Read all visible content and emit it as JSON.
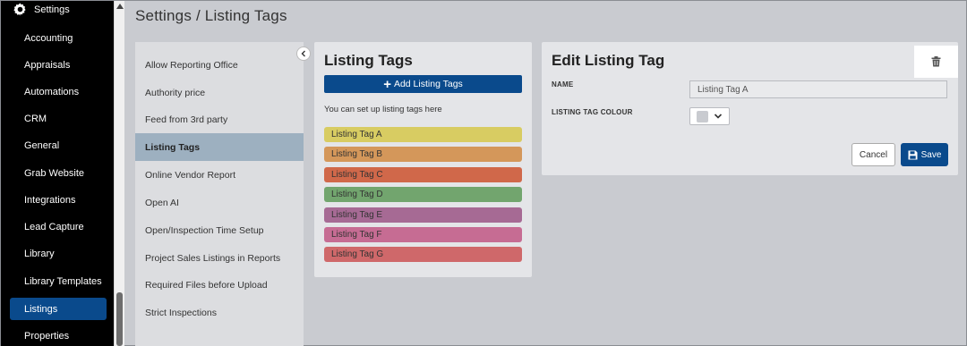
{
  "page_title": "Settings / Listing Tags",
  "sidebar": {
    "header_label": "Settings",
    "header_icon": "gear-icon",
    "items": [
      {
        "label": "Accounting"
      },
      {
        "label": "Appraisals"
      },
      {
        "label": "Automations"
      },
      {
        "label": "CRM"
      },
      {
        "label": "General"
      },
      {
        "label": "Grab Website"
      },
      {
        "label": "Integrations"
      },
      {
        "label": "Lead Capture"
      },
      {
        "label": "Library"
      },
      {
        "label": "Library Templates"
      },
      {
        "label": "Listings",
        "active": true
      },
      {
        "label": "Properties"
      }
    ]
  },
  "submenu": {
    "collapse_icon": "chevron-left-icon",
    "items": [
      {
        "label": "Allow Reporting Office"
      },
      {
        "label": "Authority price"
      },
      {
        "label": "Feed from 3rd party"
      },
      {
        "label": "Listing Tags",
        "active": true
      },
      {
        "label": "Online Vendor Report"
      },
      {
        "label": "Open AI"
      },
      {
        "label": "Open/Inspection Time Setup"
      },
      {
        "label": "Project Sales Listings in Reports"
      },
      {
        "label": "Required Files before Upload"
      },
      {
        "label": "Strict Inspections"
      }
    ]
  },
  "listing_tags": {
    "title": "Listing Tags",
    "add_button_label": "Add Listing Tags",
    "helper_text": "You can set up listing tags here",
    "tags": [
      {
        "label": "Listing Tag A",
        "color": "#d8cc62"
      },
      {
        "label": "Listing Tag B",
        "color": "#d4975a"
      },
      {
        "label": "Listing Tag C",
        "color": "#d0684a"
      },
      {
        "label": "Listing Tag D",
        "color": "#72a56e"
      },
      {
        "label": "Listing Tag E",
        "color": "#a66a94"
      },
      {
        "label": "Listing Tag F",
        "color": "#c66c93"
      },
      {
        "label": "Listing Tag G",
        "color": "#cf686a"
      }
    ]
  },
  "edit_tag": {
    "title": "Edit Listing Tag",
    "delete_icon": "trash-icon",
    "name_label": "NAME",
    "name_value": "Listing Tag A",
    "colour_label": "LISTING TAG COLOUR",
    "colour_value": "#c9cbd0",
    "cancel_label": "Cancel",
    "save_label": "Save"
  },
  "colors": {
    "accent": "#0a4a8c",
    "sidebar_bg": "#000000",
    "active_submenu": "#9db0c0"
  }
}
